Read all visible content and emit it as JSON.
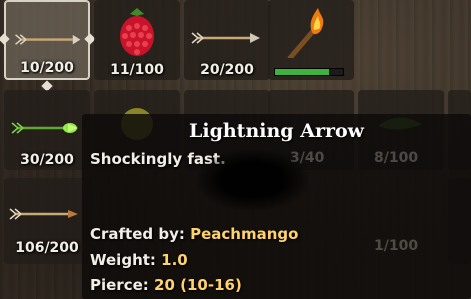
{
  "slots": [
    {
      "id": "arrow-wood",
      "count": "10/200",
      "icon": "wood-arrow-icon",
      "selected": true
    },
    {
      "id": "raspberry",
      "count": "11/100",
      "icon": "raspberry-icon"
    },
    {
      "id": "arrow-flint",
      "count": "20/200",
      "icon": "flint-arrow-icon"
    },
    {
      "id": "torch",
      "count": "",
      "icon": "torch-icon",
      "durability": 0.8
    },
    {
      "id": "arrow-lightning",
      "count": "30/200",
      "icon": "lightning-arrow-icon"
    },
    {
      "id": "hidden-1",
      "count": "3/40",
      "icon": "hidden-item-icon"
    },
    {
      "id": "hidden-2",
      "count": "8/100",
      "icon": "hidden-item-icon"
    },
    {
      "id": "arrow-bronze",
      "count": "106/200",
      "icon": "bronze-arrow-icon"
    },
    {
      "id": "hidden-3",
      "count": "1/100",
      "icon": "hidden-item-icon"
    }
  ],
  "tooltip": {
    "title": "Lightning Arrow",
    "description": "Shockingly fast.",
    "crafted_by_label": "Crafted by:",
    "crafted_by_value": "Peachmango",
    "weight_label": "Weight:",
    "weight_value": "1.0",
    "pierce_label": "Pierce:",
    "pierce_value": "20 (10-16)"
  },
  "colors": {
    "highlight": "#ffd36a",
    "durability_bar": "#3db23d",
    "slot_selected_border": "#d8d2c4"
  }
}
